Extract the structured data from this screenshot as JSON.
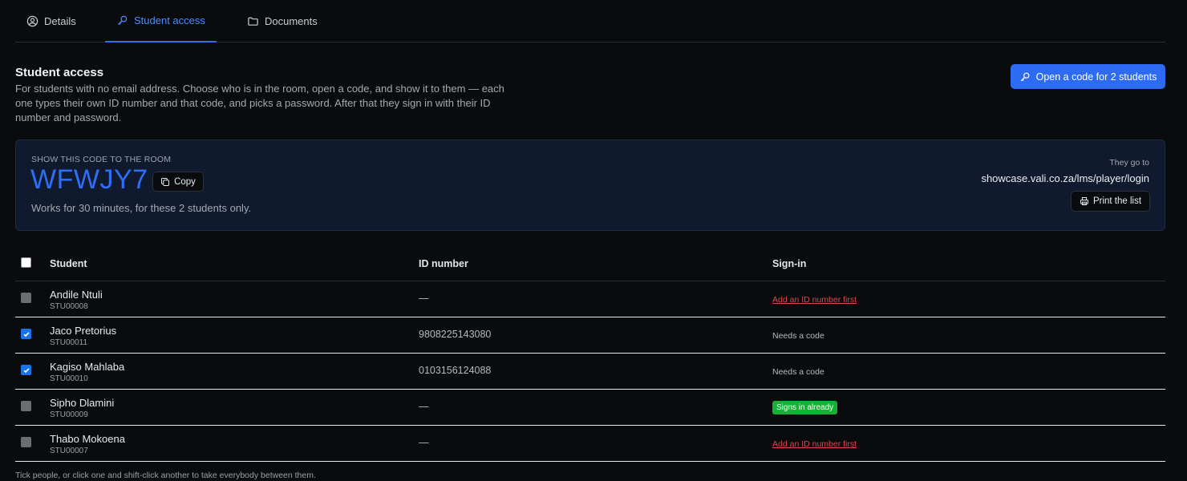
{
  "tabs": [
    {
      "label": "Details",
      "icon": "user-circle-icon"
    },
    {
      "label": "Student access",
      "icon": "key-icon"
    },
    {
      "label": "Documents",
      "icon": "folder-icon"
    }
  ],
  "active_tab": "Student access",
  "section": {
    "title": "Student access",
    "description": "For students with no email address. Choose who is in the room, open a code, and show it to them — each one types their own ID number and that code, and picks a password. After that they sign in with their ID number and password.",
    "open_button": "Open a code for 2 students"
  },
  "code_panel": {
    "eyebrow": "SHOW THIS CODE TO THE ROOM",
    "code": "WFWJY7",
    "copy_label": "Copy",
    "note": "Works for 30 minutes, for these 2 students only.",
    "go_label": "They go to",
    "url": "showcase.vali.co.za/lms/player/login",
    "print_label": "Print the list"
  },
  "table": {
    "headers": {
      "student": "Student",
      "id": "ID number",
      "signin": "Sign-in"
    },
    "rows": [
      {
        "name": "Andile Ntuli",
        "code": "STU00008",
        "id": "—",
        "signin": "Add an ID number first",
        "signin_kind": "link",
        "checked": false
      },
      {
        "name": "Jaco Pretorius",
        "code": "STU00011",
        "id": "9808225143080",
        "signin": "Needs a code",
        "signin_kind": "plain",
        "checked": true
      },
      {
        "name": "Kagiso Mahlaba",
        "code": "STU00010",
        "id": "0103156124088",
        "signin": "Needs a code",
        "signin_kind": "plain",
        "checked": true
      },
      {
        "name": "Sipho Dlamini",
        "code": "STU00009",
        "id": "—",
        "signin": "Signs in already",
        "signin_kind": "badge",
        "checked": false
      },
      {
        "name": "Thabo Mokoena",
        "code": "STU00007",
        "id": "—",
        "signin": "Add an ID number first",
        "signin_kind": "link",
        "checked": false
      }
    ]
  },
  "footnote": "Tick people, or click one and shift-click another to take everybody between them.",
  "colors": {
    "accent": "#2c6bf2",
    "danger": "#e0474a",
    "success": "#16b035",
    "panel": "#0f1a2e"
  }
}
